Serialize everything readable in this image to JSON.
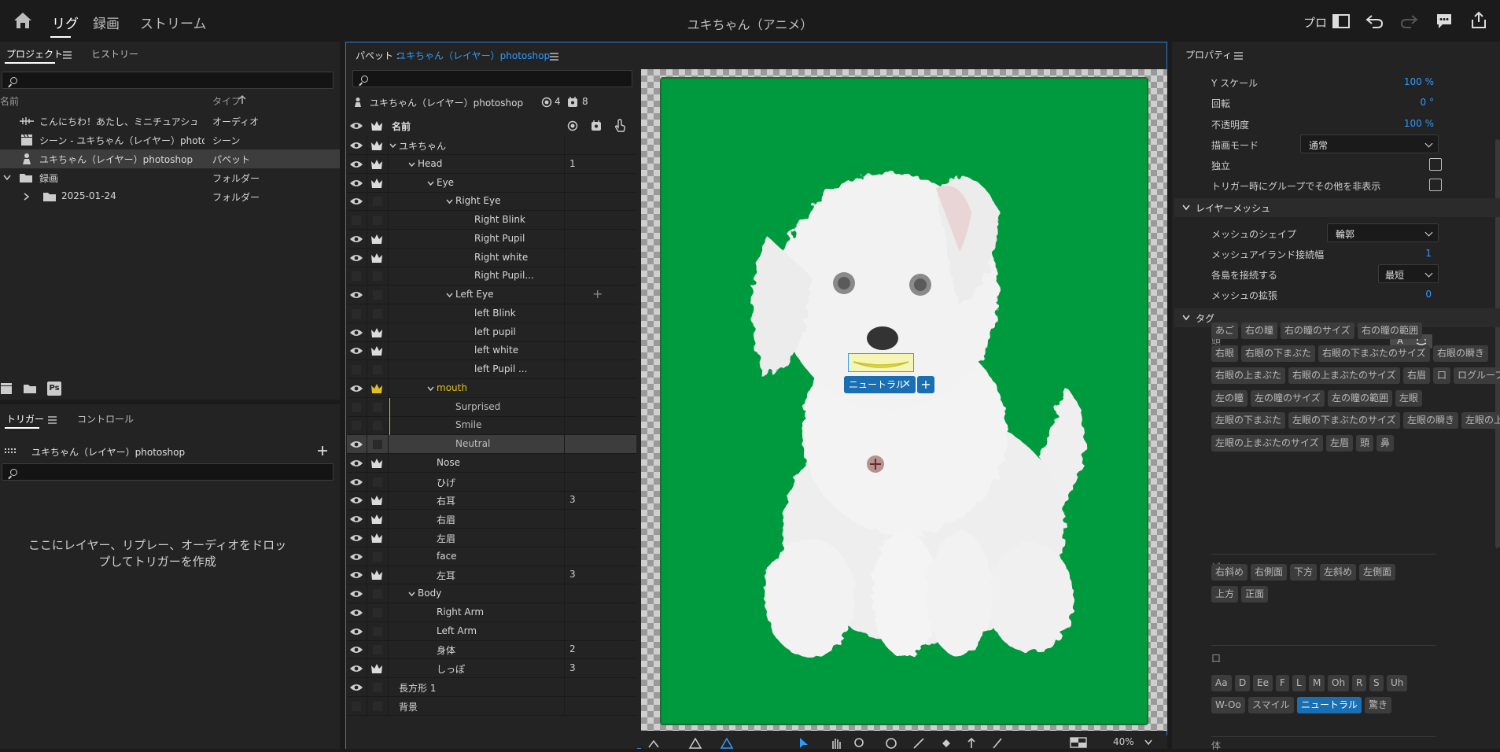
{
  "topbar": {
    "nav": [
      "リグ",
      "録画",
      "ストリーム"
    ],
    "title": "ユキちゃん（アニメ）",
    "right_label": "プロ"
  },
  "project": {
    "tabs": [
      "プロジェクト",
      "ヒストリー"
    ],
    "col_name": "名前",
    "col_type": "タイプ",
    "items": [
      {
        "name": "こんにちわ！あたし、ミニチュアシュ...",
        "type": "オーディオ"
      },
      {
        "name": "シーン - ユキちゃん（レイヤー）photo...",
        "type": "シーン"
      },
      {
        "name": "ユキちゃん（レイヤー）photoshop",
        "type": "パペット"
      },
      {
        "name": "録画",
        "type": "フォルダー"
      },
      {
        "name": "2025-01-24",
        "type": "フォルダー"
      }
    ]
  },
  "triggers": {
    "tabs": [
      "トリガー",
      "コントロール"
    ],
    "puppet": "ユキちゃん（レイヤー）photoshop",
    "drop_hint": "ここにレイヤー、リプレー、オーディオをドロップしてトリガーを作成"
  },
  "puppet_panel": {
    "title_prefix": "パペット : ",
    "title": "ユキちゃん（レイヤー）photoshop",
    "info_name": "ユキちゃん（レイヤー）photoshop",
    "info_count1": "4",
    "info_count2": "8",
    "col_name": "名前",
    "layers": [
      {
        "name": "ユキちゃん",
        "num": ""
      },
      {
        "name": "Head",
        "num": "1"
      },
      {
        "name": "Eye",
        "num": ""
      },
      {
        "name": "Right Eye",
        "num": ""
      },
      {
        "name": "Right Blink",
        "num": ""
      },
      {
        "name": "Right Pupil",
        "num": ""
      },
      {
        "name": "Right white",
        "num": ""
      },
      {
        "name": "Right Pupil...",
        "num": ""
      },
      {
        "name": "Left Eye",
        "num": ""
      },
      {
        "name": "left Blink",
        "num": ""
      },
      {
        "name": "left pupil",
        "num": ""
      },
      {
        "name": "left white",
        "num": ""
      },
      {
        "name": "left Pupil ...",
        "num": ""
      },
      {
        "name": "mouth",
        "num": ""
      },
      {
        "name": "Surprised",
        "num": ""
      },
      {
        "name": "Smile",
        "num": ""
      },
      {
        "name": "Neutral",
        "num": ""
      },
      {
        "name": "Nose",
        "num": ""
      },
      {
        "name": "ひげ",
        "num": ""
      },
      {
        "name": "右耳",
        "num": "3"
      },
      {
        "name": "右眉",
        "num": ""
      },
      {
        "name": "左眉",
        "num": ""
      },
      {
        "name": "face",
        "num": ""
      },
      {
        "name": "左耳",
        "num": "3"
      },
      {
        "name": "Body",
        "num": ""
      },
      {
        "name": "Right Arm",
        "num": ""
      },
      {
        "name": "Left Arm",
        "num": ""
      },
      {
        "name": "身体",
        "num": "2"
      },
      {
        "name": "しっぽ",
        "num": "3"
      },
      {
        "name": "長方形 1",
        "num": ""
      },
      {
        "name": "背景",
        "num": ""
      }
    ]
  },
  "canvas": {
    "tag_label": "ニュートラル",
    "zoom": "40%"
  },
  "properties": {
    "title": "プロパティ",
    "rows": [
      {
        "label": "Y スケール",
        "value": "100 %"
      },
      {
        "label": "回転",
        "value": "0 °"
      },
      {
        "label": "不透明度",
        "value": "100 %"
      }
    ],
    "blend_label": "描画モード",
    "blend_value": "通常",
    "independent_label": "独立",
    "hide_others_label": "トリガー時にグループでその他を非表示",
    "mesh_section": "レイヤーメッシュ",
    "mesh_shape_label": "メッシュのシェイプ",
    "mesh_shape_value": "輪郭",
    "mesh_island_label": "メッシュアイランド接続幅",
    "mesh_island_value": "1",
    "connect_label": "各島を接続する",
    "connect_value": "最短",
    "mesh_expand_label": "メッシュの拡張",
    "mesh_expand_value": "0",
    "tags_section": "タグ",
    "head_label": "頭",
    "head_tags": [
      "あご",
      "右の瞳",
      "右の瞳のサイズ",
      "右の瞳の範囲",
      "右眼",
      "右眼の下まぶた",
      "右眼の下まぶたのサイズ",
      "右眼の瞬き",
      "右眼の上まぶた",
      "右眼の上まぶたのサイズ",
      "右眉",
      "口",
      "ログループ",
      "左の瞳",
      "左の瞳のサイズ",
      "左の瞳の範囲",
      "左眼",
      "左眼の下まぶた",
      "左眼の下まぶたのサイズ",
      "左眼の瞬き",
      "左眼の上まぶた",
      "左眼の上まぶたのサイズ",
      "左眉",
      "頭",
      "鼻"
    ],
    "view_label": "ビュー",
    "view_tags": [
      "右斜め",
      "右側面",
      "下方",
      "左斜め",
      "左側面",
      "上方",
      "正面"
    ],
    "mouth_label": "口",
    "mouth_tags": [
      "Aa",
      "D",
      "Ee",
      "F",
      "L",
      "M",
      "Oh",
      "R",
      "S",
      "Uh",
      "W-Oo",
      "スマイル",
      "ニュートラル",
      "驚き"
    ],
    "body_label": "体"
  },
  "colors": {
    "accent": "#2d9cff",
    "canvas_green": "#009a3e",
    "crown_yellow": "#e0c020"
  }
}
